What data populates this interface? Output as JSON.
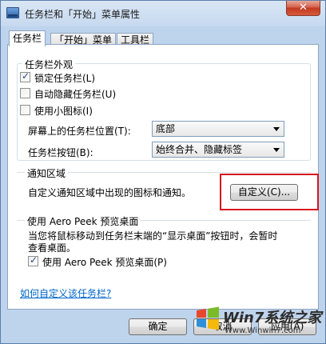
{
  "window": {
    "title": "任务栏和「开始」菜单属性",
    "close_label": "✕"
  },
  "tabs": [
    {
      "label": "任务栏",
      "active": true
    },
    {
      "label": "「开始」菜单",
      "active": false
    },
    {
      "label": "工具栏",
      "active": false
    }
  ],
  "appearance": {
    "legend": "任务栏外观",
    "lock_label": "锁定任务栏(L)",
    "lock_checked": true,
    "autohide_label": "自动隐藏任务栏(U)",
    "autohide_checked": false,
    "small_icons_label": "使用小图标(I)",
    "small_icons_checked": false,
    "position_label": "屏幕上的任务栏位置(T):",
    "position_value": "底部",
    "buttons_label": "任务栏按钮(B):",
    "buttons_value": "始终合并、隐藏标签"
  },
  "notification": {
    "legend": "通知区域",
    "description": "自定义通知区域中出现的图标和通知。",
    "customize_button": "自定义(C)..."
  },
  "aero_peek": {
    "legend": "使用 Aero Peek 预览桌面",
    "description_line1": "当您将鼠标移动到任务栏末端的“显示桌面”按钮时，会暂时",
    "description_line2": "查看桌面。",
    "checkbox_label": "使用 Aero Peek 预览桌面(P)",
    "checkbox_checked": true
  },
  "help_link": "如何自定义该任务栏?",
  "footer": {
    "ok": "确定",
    "cancel": "取消",
    "apply": "应用(A)"
  },
  "watermark": {
    "brand": "Win7系统之家",
    "site": "Www.Winwin7.com"
  },
  "colors": {
    "highlight_border": "#d8141e",
    "link": "#0066cc"
  }
}
